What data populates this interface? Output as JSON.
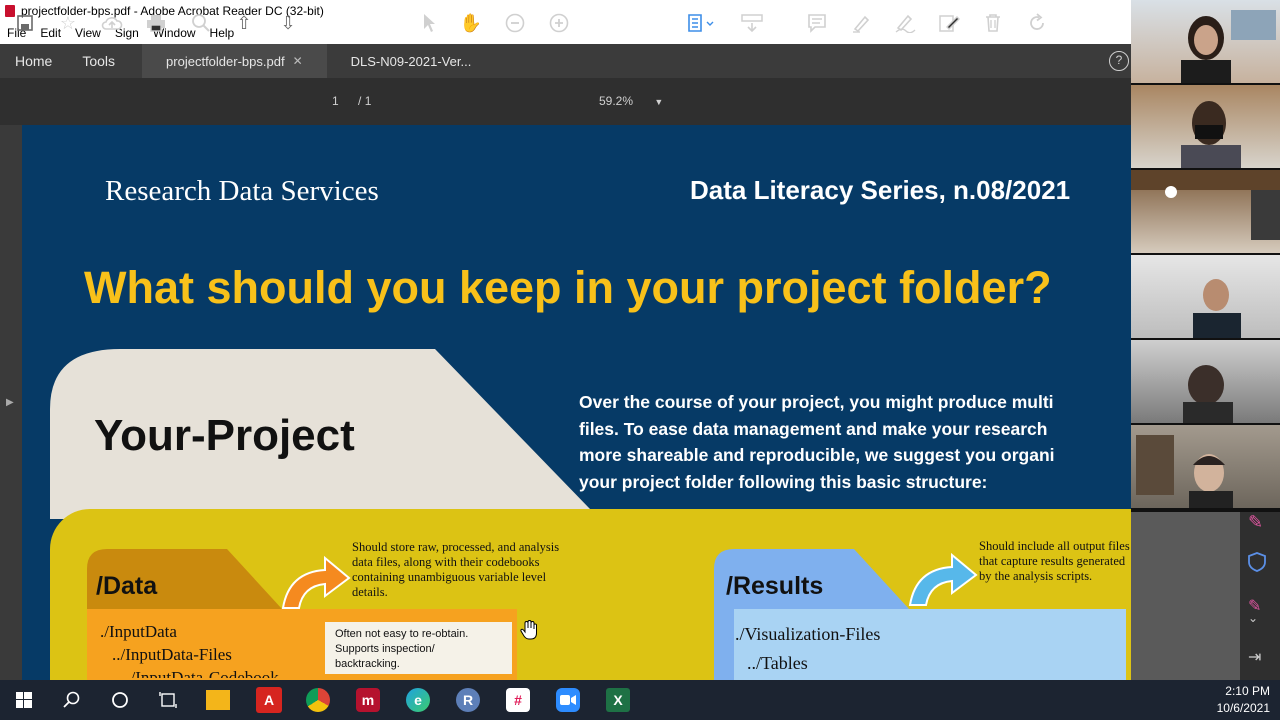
{
  "window": {
    "title": "projectfolder-bps.pdf - Adobe Acrobat Reader DC (32-bit)"
  },
  "menu": [
    "File",
    "Edit",
    "View",
    "Sign",
    "Window",
    "Help"
  ],
  "nav": {
    "home": "Home",
    "tools": "Tools"
  },
  "tabs": [
    {
      "label": "projectfolder-bps.pdf",
      "close": "✕"
    },
    {
      "label": "DLS-N09-2021-Ver..."
    }
  ],
  "toolbar": {
    "page_current": "1",
    "page_total": "/ 1",
    "zoom": "59.2%"
  },
  "document": {
    "org": "Research Data Services",
    "series": "Data Literacy Series, n.08/2021",
    "headline": "What should you keep in your project folder?",
    "project_title": "Your-Project",
    "intro_lines": [
      "Over the course of your project, you might produce multi",
      "files. To ease data management and make your research",
      "more shareable and reproducible, we suggest you organi",
      "your project folder following this basic structure:"
    ],
    "data": {
      "title": "/Data",
      "description": "Should store raw, processed, and analysis data files, along with their codebooks containing unambiguous variable level details.",
      "items": [
        "./InputData",
        "../InputData-Files",
        "../InputData-Codebook"
      ],
      "note": "Often not easy to re-obtain. Supports inspection/ backtracking."
    },
    "results": {
      "title": "/Results",
      "description": "Should include all output files that capture results generated by the analysis scripts.",
      "items": [
        "./Visualization-Files",
        "../Tables"
      ]
    }
  },
  "clock": {
    "time": "2:10 PM",
    "date": "10/6/2021"
  },
  "colors": {
    "page_bg": "#063a66",
    "headline": "#f8c11a",
    "yellow_panel": "#dcc314",
    "data_tab": "#c98a0e",
    "results_tab": "#7fb0ee"
  }
}
